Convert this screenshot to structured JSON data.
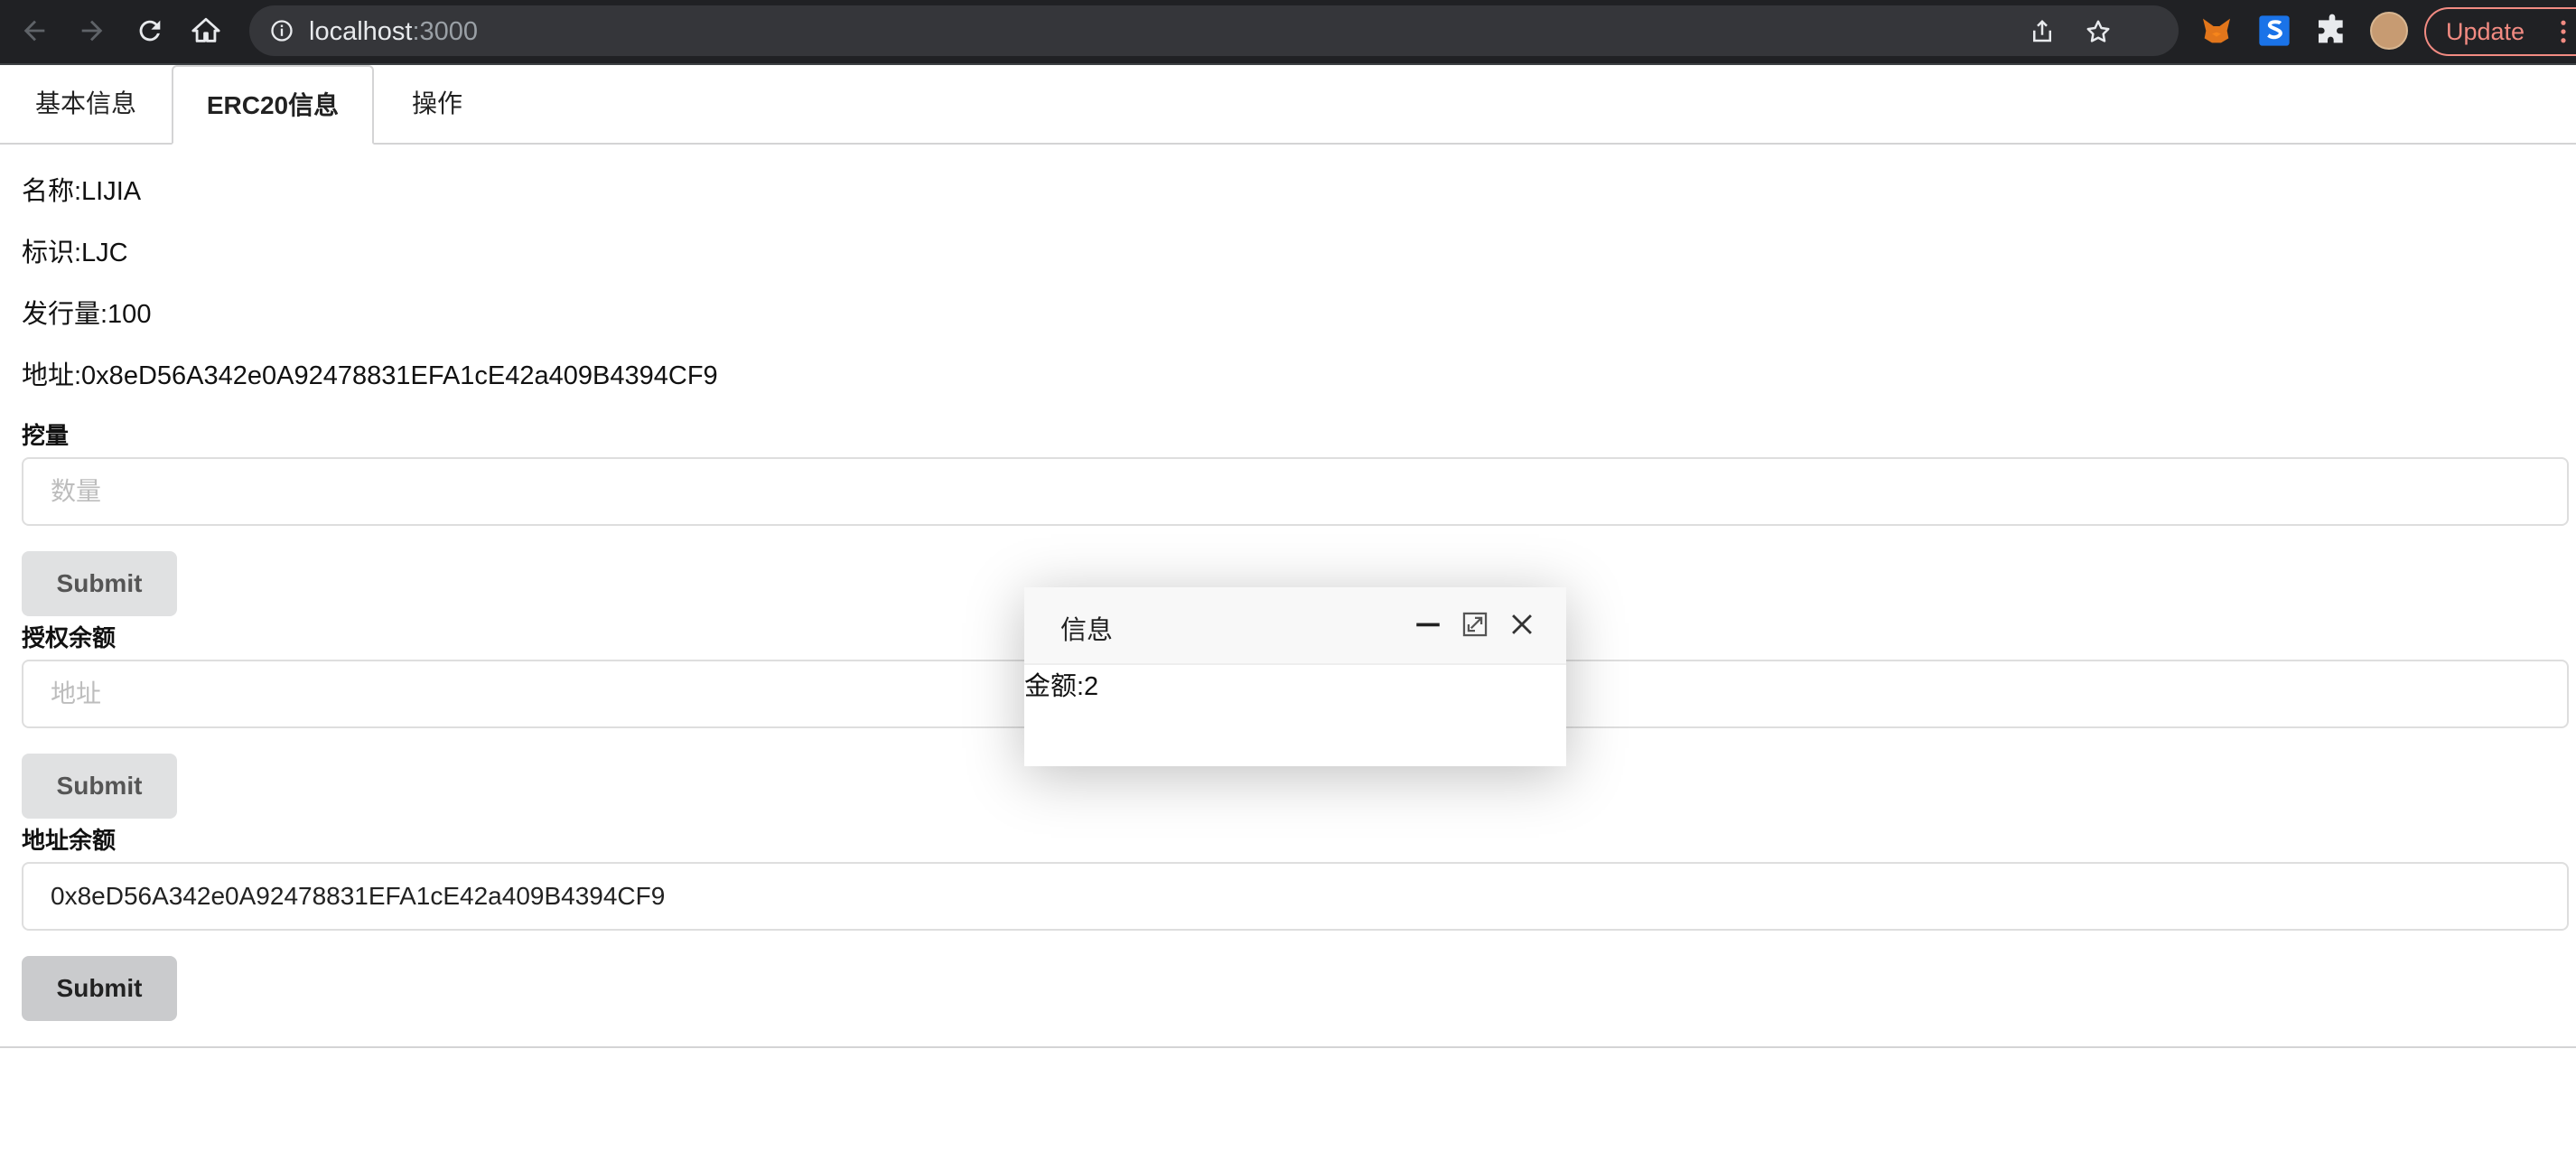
{
  "browser": {
    "url_host": "localhost",
    "url_port": ":3000",
    "update_label": "Update"
  },
  "tabs": [
    {
      "label": "基本信息",
      "active": false
    },
    {
      "label": "ERC20信息",
      "active": true
    },
    {
      "label": "操作",
      "active": false
    }
  ],
  "info": {
    "name": "名称:LIJIA",
    "symbol": "标识:LJC",
    "supply": "发行量:100",
    "address": "地址:0x8eD56A342e0A92478831EFA1cE42a409B4394CF9"
  },
  "forms": {
    "mine": {
      "label": "挖量",
      "placeholder": "数量",
      "value": "",
      "submit": "Submit"
    },
    "allowance": {
      "label": "授权余额",
      "placeholder": "地址",
      "value": "",
      "submit": "Submit"
    },
    "balance": {
      "label": "地址余额",
      "placeholder": "",
      "value": "0x8eD56A342e0A92478831EFA1cE42a409B4394CF9",
      "submit": "Submit"
    }
  },
  "modal": {
    "title": "信息",
    "body": "金额:2"
  },
  "colors": {
    "toolbar_bg": "#202124",
    "update_accent": "#f28b82",
    "button_bg": "#e0e1e2"
  }
}
